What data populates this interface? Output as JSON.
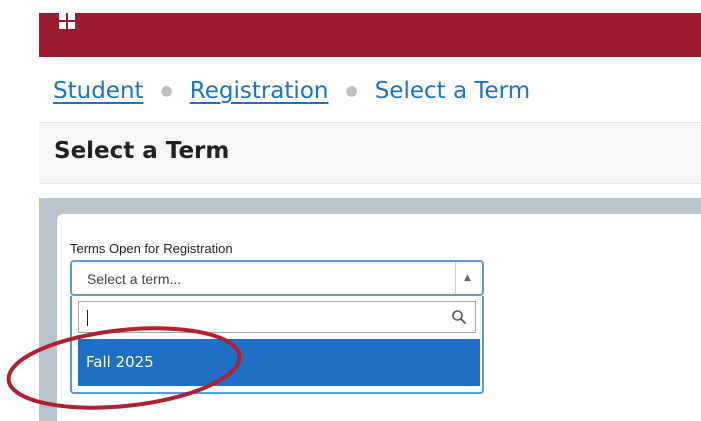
{
  "header": {
    "icon": "grid-icon",
    "color": "#9b1b30"
  },
  "breadcrumb": {
    "items": [
      {
        "label": "Student"
      },
      {
        "label": "Registration"
      }
    ],
    "current": "Select a Term"
  },
  "page": {
    "title": "Select a Term"
  },
  "term_select": {
    "label": "Terms Open for Registration",
    "placeholder": "Select a term...",
    "search_value": "",
    "options": [
      "Fall 2025"
    ],
    "highlighted": "Fall 2025",
    "accent": "#1f6fc5"
  },
  "annotation": {
    "shape": "red-ellipse",
    "color": "#b0202e"
  }
}
